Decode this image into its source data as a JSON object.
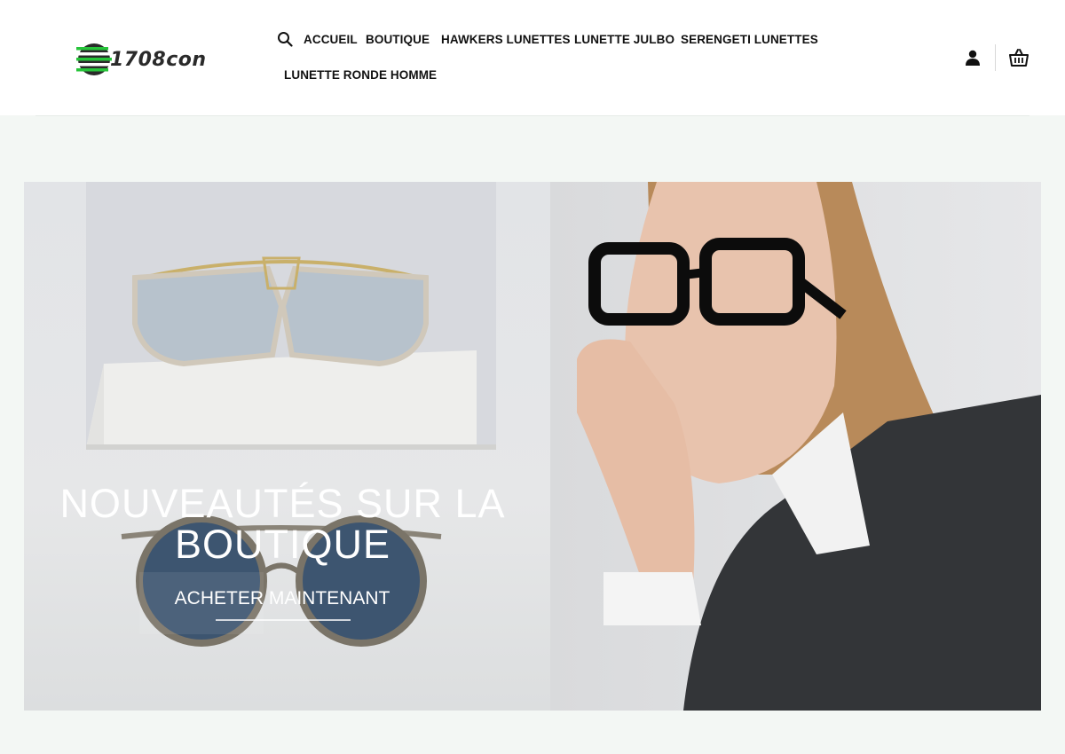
{
  "brand": {
    "logo_text": "1708con"
  },
  "nav": {
    "items": [
      {
        "label": "ACCUEIL"
      },
      {
        "label": "BOUTIQUE"
      },
      {
        "label": "HAWKERS LUNETTES"
      },
      {
        "label": "LUNETTE JULBO"
      },
      {
        "label": "SERENGETI LUNETTES"
      },
      {
        "label": "LUNETTE RONDE HOMME"
      }
    ]
  },
  "header_icons": {
    "search": "search-icon",
    "account": "user-icon",
    "cart": "basket-icon"
  },
  "hero": {
    "title": "NOUVEAUTÉS SUR LA BOUTIQUE",
    "cta_label": "ACHETER MAINTENANT"
  },
  "colors": {
    "header_bg": "#ffffff",
    "page_bg": "#f3f7f4",
    "logo_green": "#27c43a",
    "logo_dark": "#2a2a2a"
  }
}
